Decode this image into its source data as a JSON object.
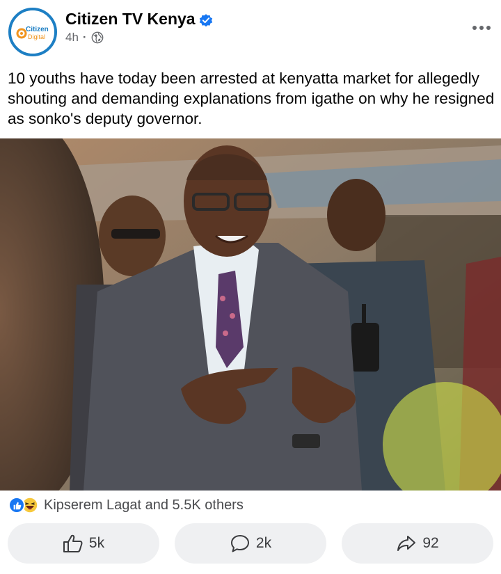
{
  "post": {
    "page_name": "Citizen TV Kenya",
    "time_ago": "4h",
    "separator": "·",
    "avatar_logo_text": [
      "Citizen",
      "Digital"
    ],
    "caption": "10 youths have today been arrested at kenyatta market for allegedly shouting and demanding explanations from igathe on why he resigned as sonko's deputy governor.",
    "icons": {
      "verified": "verified-badge-icon",
      "audience": "globe-icon",
      "menu": "more-dots-icon"
    }
  },
  "photo": {
    "description_icon": "news-photo"
  },
  "reactions": {
    "icons": [
      "like-icon",
      "haha-icon"
    ],
    "summary": "Kipserem Lagat and 5.5K others"
  },
  "actions": {
    "like_count": "5k",
    "comment_count": "2k",
    "share_count": "92"
  },
  "colors": {
    "brand_blue": "#1d7fc4",
    "logo_orange": "#f0941e",
    "like_blue": "#1877f2",
    "verified_blue": "#1877f2",
    "button_bg": "#eff0f2"
  }
}
